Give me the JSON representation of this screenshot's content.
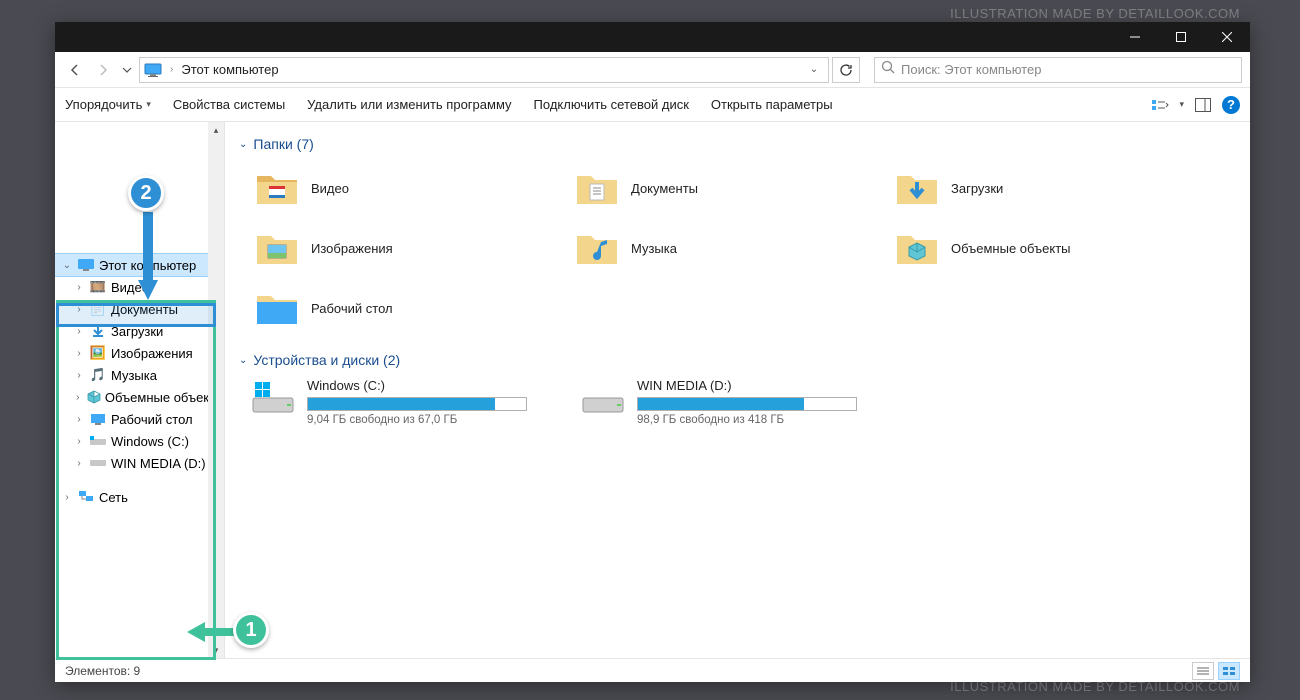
{
  "watermark": "ILLUSTRATION MADE BY DETAILLOOK.COM",
  "titlebar": {
    "min": "—",
    "max": "🗖",
    "close": "✕"
  },
  "address": {
    "location": "Этот компьютер",
    "refresh": "↻",
    "search_placeholder": "Поиск: Этот компьютер"
  },
  "toolbar": {
    "organize": "Упорядочить",
    "props": "Свойства системы",
    "uninstall": "Удалить или изменить программу",
    "netdrive": "Подключить сетевой диск",
    "settings": "Открыть параметры"
  },
  "sidebar": {
    "this_pc": "Этот компьютер",
    "items": [
      {
        "label": "Видео"
      },
      {
        "label": "Документы"
      },
      {
        "label": "Загрузки"
      },
      {
        "label": "Изображения"
      },
      {
        "label": "Музыка"
      },
      {
        "label": "Объемные объек…"
      },
      {
        "label": "Рабочий стол"
      },
      {
        "label": "Windows (C:)"
      },
      {
        "label": "WIN MEDIA (D:)"
      }
    ],
    "network": "Сеть"
  },
  "content": {
    "folders_header": "Папки (7)",
    "folders": [
      {
        "label": "Видео"
      },
      {
        "label": "Документы"
      },
      {
        "label": "Загрузки"
      },
      {
        "label": "Изображения"
      },
      {
        "label": "Музыка"
      },
      {
        "label": "Объемные объекты"
      },
      {
        "label": "Рабочий стол"
      }
    ],
    "drives_header": "Устройства и диски (2)",
    "drives": [
      {
        "name": "Windows (C:)",
        "free": "9,04 ГБ свободно из 67,0 ГБ",
        "fill_pct": 86
      },
      {
        "name": "WIN MEDIA (D:)",
        "free": "98,9 ГБ свободно из 418 ГБ",
        "fill_pct": 76
      }
    ]
  },
  "status": {
    "count": "Элементов: 9"
  },
  "annotations": {
    "one": "1",
    "two": "2"
  }
}
